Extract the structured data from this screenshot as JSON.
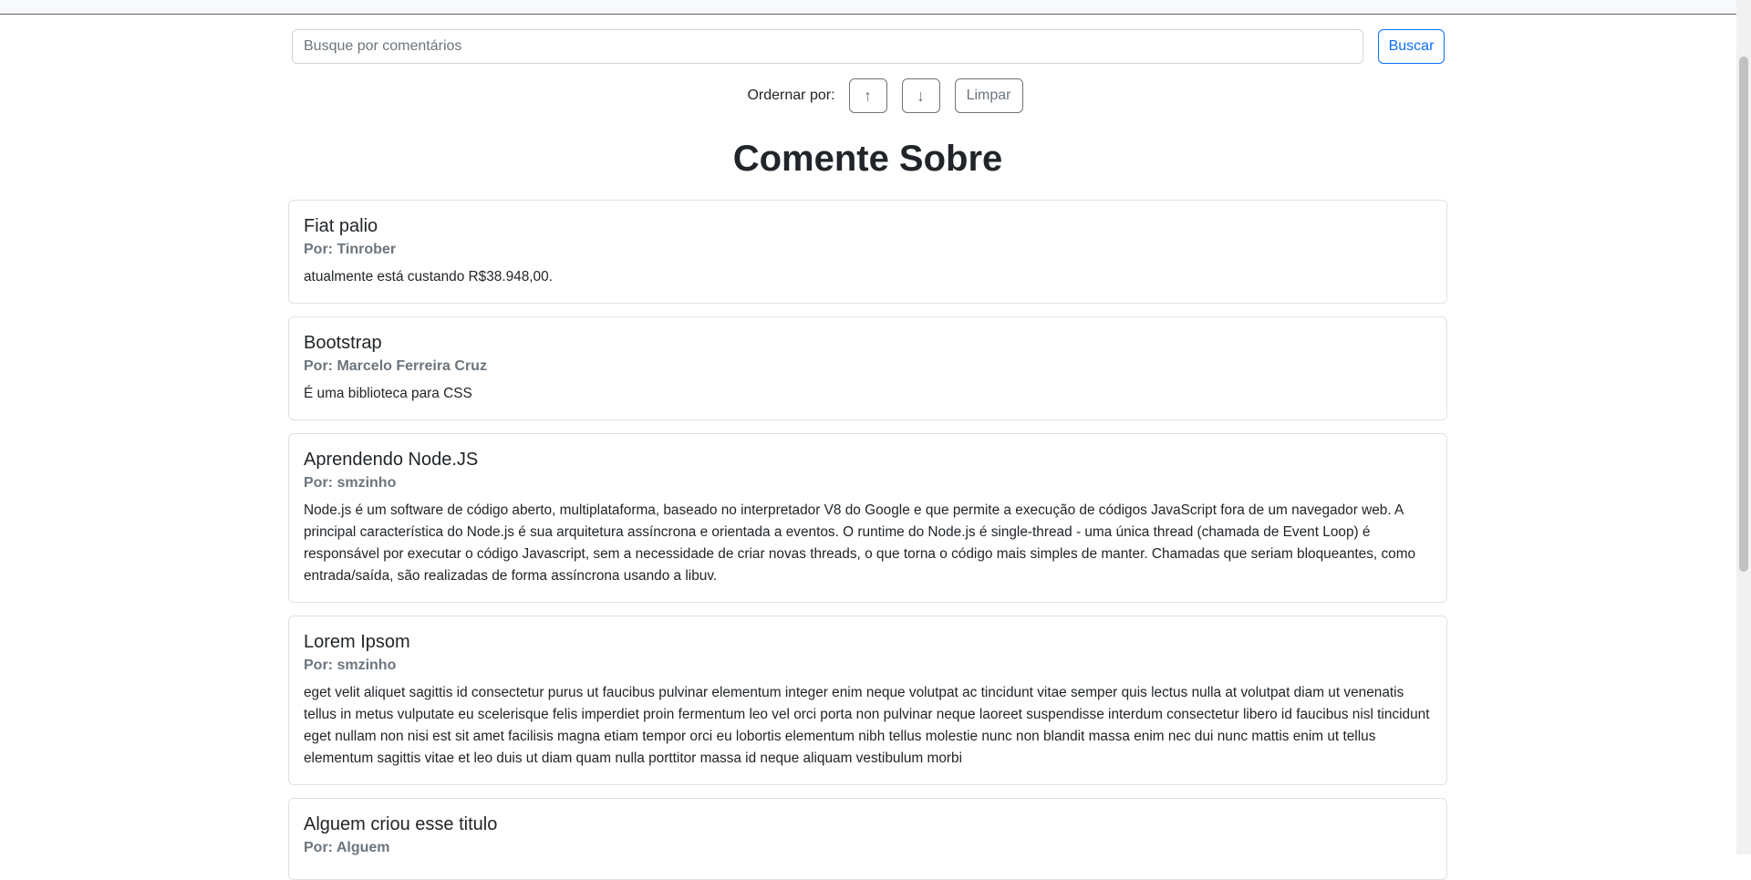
{
  "search": {
    "placeholder": "Busque por comentários",
    "button_label": "Buscar"
  },
  "order": {
    "label": "Ordernar por:",
    "asc_glyph": "↑",
    "desc_glyph": "↓",
    "clear_label": "Limpar"
  },
  "page_title": "Comente Sobre",
  "posts": [
    {
      "title": "Fiat palio",
      "author": "Por: Tinrober",
      "body": "atualmente está custando R$38.948,00."
    },
    {
      "title": "Bootstrap",
      "author": "Por: Marcelo Ferreira Cruz",
      "body": "É uma biblioteca para CSS"
    },
    {
      "title": "Aprendendo Node.JS",
      "author": "Por: smzinho",
      "body": "Node.js é um software de código aberto, multiplataforma, baseado no interpretador V8 do Google e que permite a execução de códigos JavaScript fora de um navegador web. A principal característica do Node.js é sua arquitetura assíncrona e orientada a eventos. O runtime do Node.js é single-thread - uma única thread (chamada de Event Loop) é responsável por executar o código Javascript, sem a necessidade de criar novas threads, o que torna o código mais simples de manter. Chamadas que seriam bloqueantes, como entrada/saída, são realizadas de forma assíncrona usando a libuv."
    },
    {
      "title": "Lorem Ipsom",
      "author": "Por: smzinho",
      "body": "eget velit aliquet sagittis id consectetur purus ut faucibus pulvinar elementum integer enim neque volutpat ac tincidunt vitae semper quis lectus nulla at volutpat diam ut venenatis tellus in metus vulputate eu scelerisque felis imperdiet proin fermentum leo vel orci porta non pulvinar neque laoreet suspendisse interdum consectetur libero id faucibus nisl tincidunt eget nullam non nisi est sit amet facilisis magna etiam tempor orci eu lobortis elementum nibh tellus molestie nunc non blandit massa enim nec dui nunc mattis enim ut tellus elementum sagittis vitae et leo duis ut diam quam nulla porttitor massa id neque aliquam vestibulum morbi"
    },
    {
      "title": "Alguem criou esse titulo",
      "author": "Por: Alguem",
      "body": ""
    }
  ]
}
